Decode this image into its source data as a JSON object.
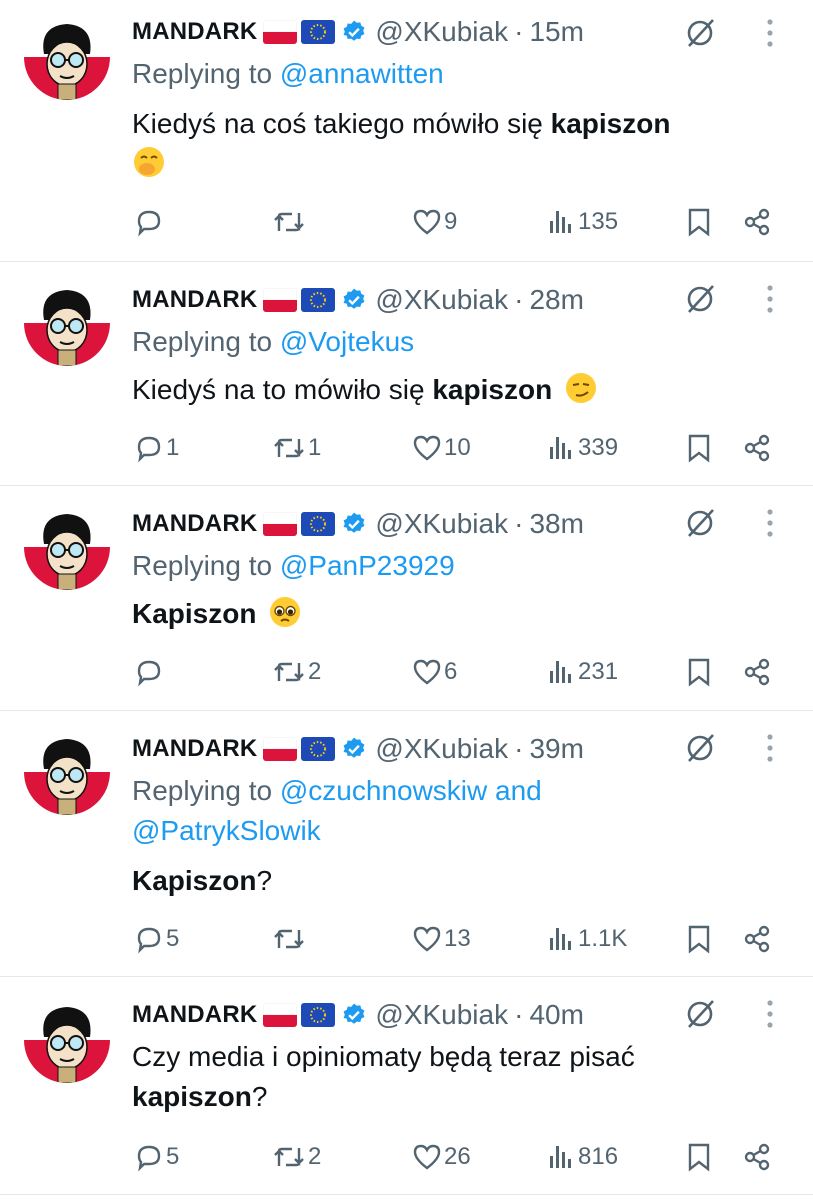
{
  "tweets": [
    {
      "name": "MANDARK",
      "handle": "@XKubiak",
      "sep": "·",
      "time": "15m",
      "reply_prefix": "Replying to",
      "reply_to": "@annawitten",
      "reply_to_2": "",
      "reply_joiner": "",
      "text_plain": "Kiedyś na coś takiego mówiło się",
      "text_bold": "kapiszon",
      "text_tail": "",
      "emoji": "🤭",
      "replies": "",
      "retweets": "",
      "likes": "9",
      "views": "135"
    },
    {
      "name": "MANDARK",
      "handle": "@XKubiak",
      "sep": "·",
      "time": "28m",
      "reply_prefix": "Replying to",
      "reply_to": "@Vojtekus",
      "reply_to_2": "",
      "reply_joiner": "",
      "text_plain": "Kiedyś na to mówiło się",
      "text_bold": "kapiszon",
      "text_tail": "",
      "emoji": "😏",
      "replies": "1",
      "retweets": "1",
      "likes": "10",
      "views": "339"
    },
    {
      "name": "MANDARK",
      "handle": "@XKubiak",
      "sep": "·",
      "time": "38m",
      "reply_prefix": "Replying to",
      "reply_to": "@PanP23929",
      "reply_to_2": "",
      "reply_joiner": "",
      "text_plain": "",
      "text_bold": "Kapiszon",
      "text_tail": "",
      "emoji": "🥺",
      "replies": "",
      "retweets": "2",
      "likes": "6",
      "views": "231"
    },
    {
      "name": "MANDARK",
      "handle": "@XKubiak",
      "sep": "·",
      "time": "39m",
      "reply_prefix": "Replying to",
      "reply_to": "@czuchnowskiw",
      "reply_joiner": "and",
      "reply_to_2": "@PatrykSlowik",
      "text_plain": "",
      "text_bold": "Kapiszon",
      "text_tail": "?",
      "emoji": "",
      "replies": "5",
      "retweets": "",
      "likes": "13",
      "views": "1.1K"
    },
    {
      "name": "MANDARK",
      "handle": "@XKubiak",
      "sep": "·",
      "time": "40m",
      "text_line1": "Czy media i opiniomaty będą teraz pisać",
      "text_bold": "kapiszon",
      "text_tail": "?",
      "replies": "5",
      "retweets": "2",
      "likes": "26",
      "views": "816"
    }
  ],
  "icons": {
    "reply": "speech-bubble-icon",
    "retweet": "retweet-arrows-icon",
    "like": "heart-icon",
    "views": "bar-chart-icon",
    "bookmark": "bookmark-icon",
    "share": "share-icon",
    "grok": "slashed-circle-icon",
    "more": "vertical-dots-icon"
  },
  "colors": {
    "link": "#1d9bf0",
    "muted": "#536471",
    "verified": "#1d9bf0"
  }
}
